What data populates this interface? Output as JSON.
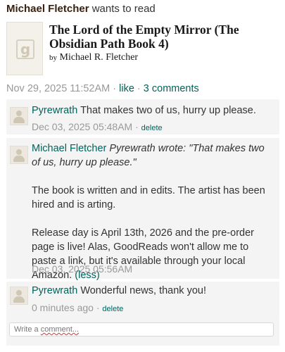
{
  "header": {
    "user": "Michael Fletcher",
    "action": "wants to read"
  },
  "book": {
    "title": "The Lord of the Empty Mirror (The Obsidian Path Book 4)",
    "by_label": "by",
    "author": "Michael R. Fletcher",
    "cover_icon": "goodreads-g-icon"
  },
  "meta": {
    "timestamp": "Nov 29, 2025 11:52AM",
    "sep1": " · ",
    "like": "like",
    "sep2": " · ",
    "comments": "3 comments"
  },
  "comments": [
    {
      "author": "Pyrewrath",
      "text": "That makes two of us, hurry up please.",
      "time": "Dec 03, 2025 05:48AM",
      "sep": " · ",
      "delete": "delete"
    },
    {
      "author": "Michael Fletcher",
      "quote": "Pyrewrath wrote: \"That makes two of us, hurry up please.\"",
      "para1": "The book is written and in edits. The artist has been hired and is arting.",
      "para2": "Release day is April 13th, 2026 and the pre-order page is live! Alas, GoodReads won't allow me to paste a link, but it's available through your local Amazon.",
      "less": "(less)",
      "time": "Dec 03, 2025 05:56AM"
    },
    {
      "author": "Pyrewrath",
      "text": "Wonderful news, thank you!",
      "time": "0 minutes ago",
      "sep": " · ",
      "delete": "delete"
    }
  ],
  "comment_input": {
    "placeholder_start": "Write a ",
    "placeholder_err": "comment...",
    "icon": "user-avatar-icon"
  }
}
